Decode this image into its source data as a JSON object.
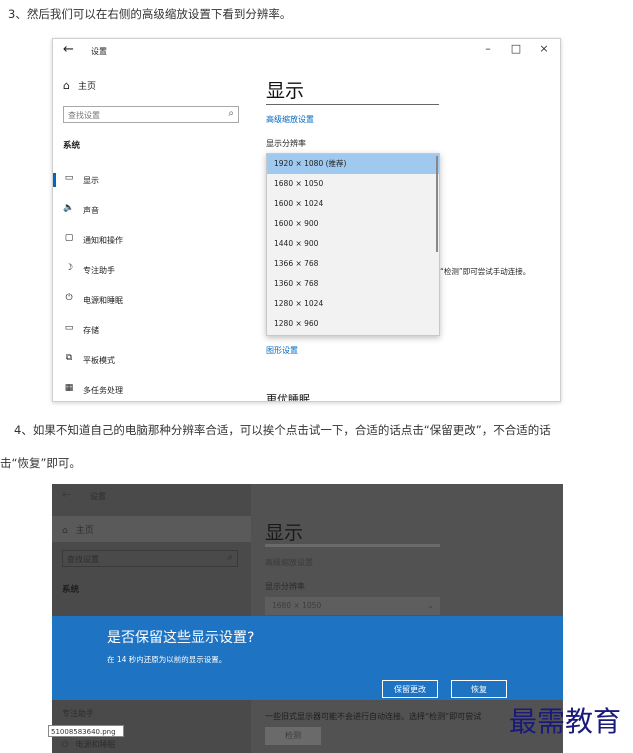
{
  "steps": {
    "step3": "3、然后我们可以在右侧的高级缩放设置下看到分辨率。",
    "step4_line1": "4、如果不知道自己的电脑那种分辨率合适，可以挨个点击试一下，合适的话点击“保留更改”，不合适的话",
    "step4_line2": "击“恢复”即可。"
  },
  "window1": {
    "title": "设置",
    "back_icon": "←",
    "minimize": "–",
    "maximize": "□",
    "close": "×",
    "home_label": "主页",
    "search_placeholder": "查找设置",
    "section": "系统",
    "nav": [
      {
        "icon": "▭",
        "label": "显示"
      },
      {
        "icon": "🔈",
        "label": "声音"
      },
      {
        "icon": "▢",
        "label": "通知和操作"
      },
      {
        "icon": "☽",
        "label": "专注助手"
      },
      {
        "icon": "⏻",
        "label": "电源和睡眠"
      },
      {
        "icon": "▭",
        "label": "存储"
      },
      {
        "icon": "⧉",
        "label": "平板模式"
      },
      {
        "icon": "▦",
        "label": "多任务处理"
      }
    ],
    "main_title": "显示",
    "advanced_link": "高级缩放设置",
    "resolution_label": "显示分辨率",
    "resolution_options": [
      "1920 × 1080 (推荐)",
      "1680 × 1050",
      "1600 × 1024",
      "1600 × 900",
      "1440 × 900",
      "1366 × 768",
      "1360 × 768",
      "1280 × 1024",
      "1280 × 960"
    ],
    "selected_option": "1920 × 1080 (推荐)",
    "hint_partial": "“检测”即可尝试手动连接。",
    "graphics_link": "图形设置",
    "bottom_heading": "更优睡眠"
  },
  "window2": {
    "title": "设置",
    "back_icon": "←",
    "home_label": "主页",
    "search_placeholder": "查找设置",
    "section": "系统",
    "main_title": "显示",
    "advanced_link": "高级缩放设置",
    "resolution_label": "显示分辨率",
    "resolution_value": "1680 × 1050",
    "dialog_title": "是否保留这些显示设置?",
    "dialog_subtitle": "在 14 秒内还原为以前的显示设置。",
    "keep_button": "保留更改",
    "revert_button": "恢复",
    "partial_text": "一些旧式显示器可能不会进行自动连接。选择“检测”即可尝试",
    "detect_button": "检测",
    "tooltip": "51008583640.png",
    "nav_partial": "专注助手",
    "nav_partial2": "电源和睡眠"
  },
  "watermark": "最需教育"
}
